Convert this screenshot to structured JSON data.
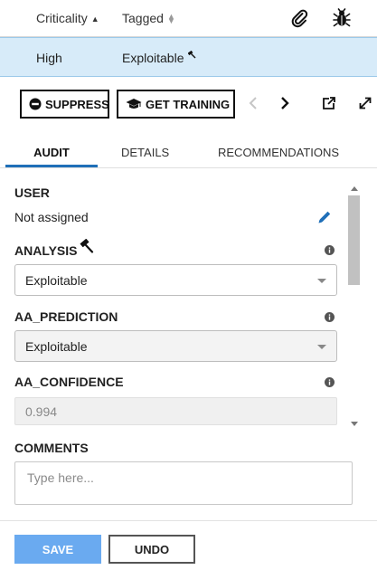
{
  "table": {
    "columns": [
      {
        "label": "Criticality",
        "sort": "ascending"
      },
      {
        "label": "Tagged",
        "sort": "none"
      }
    ],
    "header_icons": [
      "paperclip-icon",
      "bug-icon"
    ],
    "selected_row": {
      "criticality": "High",
      "tagged": "Exploitable"
    }
  },
  "toolbar": {
    "suppress_label": "SUPPRESS",
    "training_label": "GET TRAINING",
    "icons": [
      "chevron-left-icon",
      "chevron-right-icon",
      "external-link-icon",
      "expand-icon"
    ]
  },
  "tabs": [
    {
      "label": "AUDIT",
      "active": true
    },
    {
      "label": "DETAILS",
      "active": false
    },
    {
      "label": "RECOMMENDATIONS",
      "active": false
    }
  ],
  "audit": {
    "user_label": "USER",
    "user_value": "Not assigned",
    "analysis_label": "ANALYSIS",
    "analysis_value": "Exploitable",
    "aa_prediction_label": "AA_PREDICTION",
    "aa_prediction_value": "Exploitable",
    "aa_confidence_label": "AA_CONFIDENCE",
    "aa_confidence_value": "0.994",
    "comments_label": "COMMENTS",
    "comments_placeholder": "Type here..."
  },
  "footer": {
    "save_label": "SAVE",
    "undo_label": "UNDO"
  },
  "colors": {
    "accent": "#1f6fb8",
    "selected_row_bg": "#d7ebf9",
    "save_button_bg": "#6aaaf0"
  }
}
